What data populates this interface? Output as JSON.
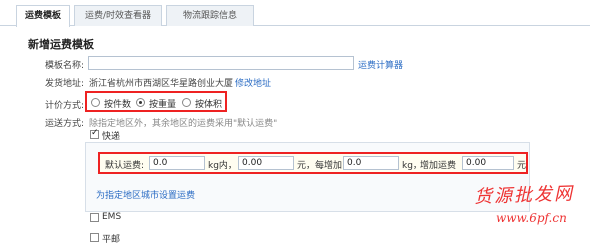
{
  "tabs": [
    {
      "label": "运费模板"
    },
    {
      "label": "运费/时效查看器"
    },
    {
      "label": "物流跟踪信息"
    }
  ],
  "page_title": "新增运费模板",
  "form": {
    "name_label": "模板名称:",
    "name_value": "",
    "calc_link": "运费计算器",
    "address_label": "发货地址:",
    "address_value": "浙江省杭州市西湖区华星路创业大厦",
    "edit_address_link": "修改地址",
    "pricing_label": "计价方式:",
    "pricing_options": [
      {
        "label": "按件数",
        "checked": false
      },
      {
        "label": "按重量",
        "checked": true
      },
      {
        "label": "按体积",
        "checked": false
      }
    ],
    "shipping_label": "运送方式:",
    "shipping_note": "除指定地区外，其余地区的运费采用\"默认运费\"",
    "methods": {
      "express": {
        "label": "快递",
        "checked": true
      },
      "ems": {
        "label": "EMS",
        "checked": false
      },
      "mail": {
        "label": "平邮",
        "checked": false
      }
    },
    "default_fee": {
      "label": "默认运费:",
      "first_weight": "0.0",
      "unit_within": "kg内，",
      "first_fee": "0.00",
      "unit_yuan_1": "元，",
      "each_add_label": "每增加",
      "add_weight": "0.0",
      "unit_kg": "kg，",
      "add_fee_label": "增加运费",
      "add_fee": "0.00",
      "unit_yuan_2": "元"
    },
    "city_link": "为指定地区城市设置运费"
  },
  "watermark": {
    "line1": "货源批发网",
    "line2": "www.6pf.cn"
  }
}
